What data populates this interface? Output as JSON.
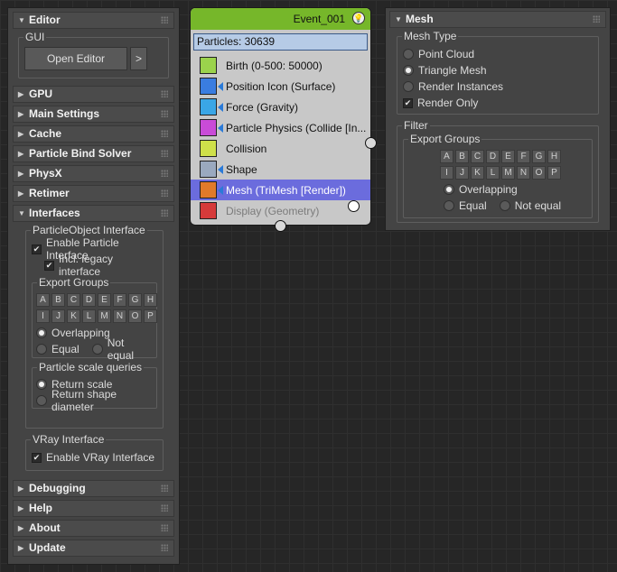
{
  "left": {
    "editor": {
      "title": "Editor",
      "gui_title": "GUI",
      "open_editor": "Open Editor",
      "more": ">"
    },
    "rollouts_top": [
      "GPU",
      "Main Settings",
      "Cache",
      "Particle Bind Solver",
      "PhysX",
      "Retimer"
    ],
    "interfaces": {
      "title": "Interfaces",
      "po_title": "ParticleObject Interface",
      "enable_particle": "Enable Particle Interface",
      "legacy": "Incl. legacy interface",
      "export_groups": "Export Groups",
      "letters": [
        "A",
        "B",
        "C",
        "D",
        "E",
        "F",
        "G",
        "H",
        "I",
        "J",
        "K",
        "L",
        "M",
        "N",
        "O",
        "P"
      ],
      "overlapping": "Overlapping",
      "equal": "Equal",
      "not_equal": "Not equal",
      "scale_title": "Particle scale queries",
      "return_scale": "Return scale",
      "return_shape": "Return shape diameter",
      "vray_title": "VRay Interface",
      "enable_vray": "Enable VRay Interface"
    },
    "rollouts_bottom": [
      "Debugging",
      "Help",
      "About",
      "Update"
    ],
    "check_mark": "✔",
    "arrow_open": "▼",
    "arrow_closed": "▶"
  },
  "node": {
    "title": "Event_001",
    "bulb": "💡",
    "particles": "Particles: 30639",
    "operators": [
      {
        "label": "Birth (0-500: 50000)",
        "icon": "birth-icon",
        "color": "#9bd34c"
      },
      {
        "label": "Position Icon (Surface)",
        "icon": "position-icon-icon",
        "color": "#3a7de0"
      },
      {
        "label": "Force (Gravity)",
        "icon": "force-icon",
        "color": "#3aa6e6"
      },
      {
        "label": "Particle Physics (Collide [In...",
        "icon": "particle-physics-icon",
        "color": "#c94bd8"
      },
      {
        "label": "Collision",
        "icon": "collision-icon",
        "color": "#cfe04a"
      },
      {
        "label": "Shape",
        "icon": "shape-icon",
        "color": "#9aa9bf"
      },
      {
        "label": "Mesh (TriMesh [Render])",
        "icon": "mesh-icon",
        "color": "#e07a2a"
      },
      {
        "label": "Display (Geometry)",
        "icon": "display-icon",
        "color": "#d63a3a"
      }
    ],
    "selected_color": "#6b6cdd",
    "header_color": "#76b72a"
  },
  "mesh": {
    "title": "Mesh",
    "type_title": "Mesh Type",
    "point_cloud": "Point Cloud",
    "triangle_mesh": "Triangle Mesh",
    "render_instances": "Render Instances",
    "render_only": "Render Only",
    "filter_title": "Filter",
    "export_groups": "Export Groups",
    "overlapping": "Overlapping",
    "equal": "Equal",
    "not_equal": "Not equal"
  }
}
